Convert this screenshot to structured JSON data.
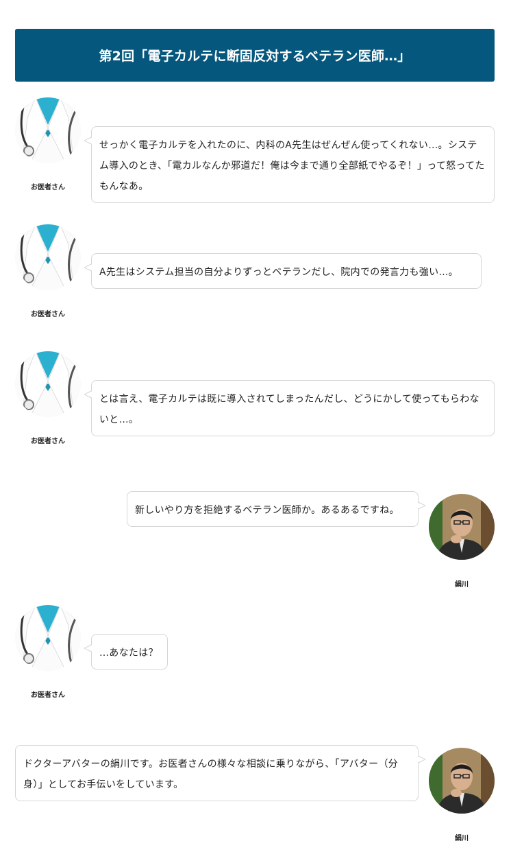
{
  "header": {
    "title": "第2回「電子カルテに断固反対するベテラン医師…」"
  },
  "colors": {
    "header_bg": "#05577d",
    "bubble_border": "#d6d6d6",
    "scrubs": "#2bb0cf"
  },
  "conversation": [
    {
      "side": "left",
      "speaker": "お医者さん",
      "avatar": "doctor-avatar",
      "text": "せっかく電子カルテを入れたのに、内科のA先生はぜんぜん使ってくれない…。システム導入のとき、「電カルなんか邪道だ！俺は今まで通り全部紙でやるぞ！」って怒ってたもんなあ。"
    },
    {
      "side": "left",
      "speaker": "お医者さん",
      "avatar": "doctor-avatar",
      "text": "A先生はシステム担当の自分よりずっとベテランだし、院内での発言力も強い…。"
    },
    {
      "side": "left",
      "speaker": "お医者さん",
      "avatar": "doctor-avatar",
      "text": "とは言え、電子カルテは既に導入されてしまったんだし、どうにかして使ってもらわないと…。"
    },
    {
      "side": "right",
      "speaker": "絹川",
      "avatar": "kinukawa-avatar",
      "text": "新しいやり方を拒絶するベテラン医師か。あるあるですね。"
    },
    {
      "side": "left",
      "speaker": "お医者さん",
      "avatar": "doctor-avatar",
      "text": "…あなたは？"
    },
    {
      "side": "right",
      "speaker": "絹川",
      "avatar": "kinukawa-avatar",
      "text": "ドクターアバターの絹川です。お医者さんの様々な相談に乗りながら、「アバター（分身）」としてお手伝いをしています。"
    }
  ]
}
